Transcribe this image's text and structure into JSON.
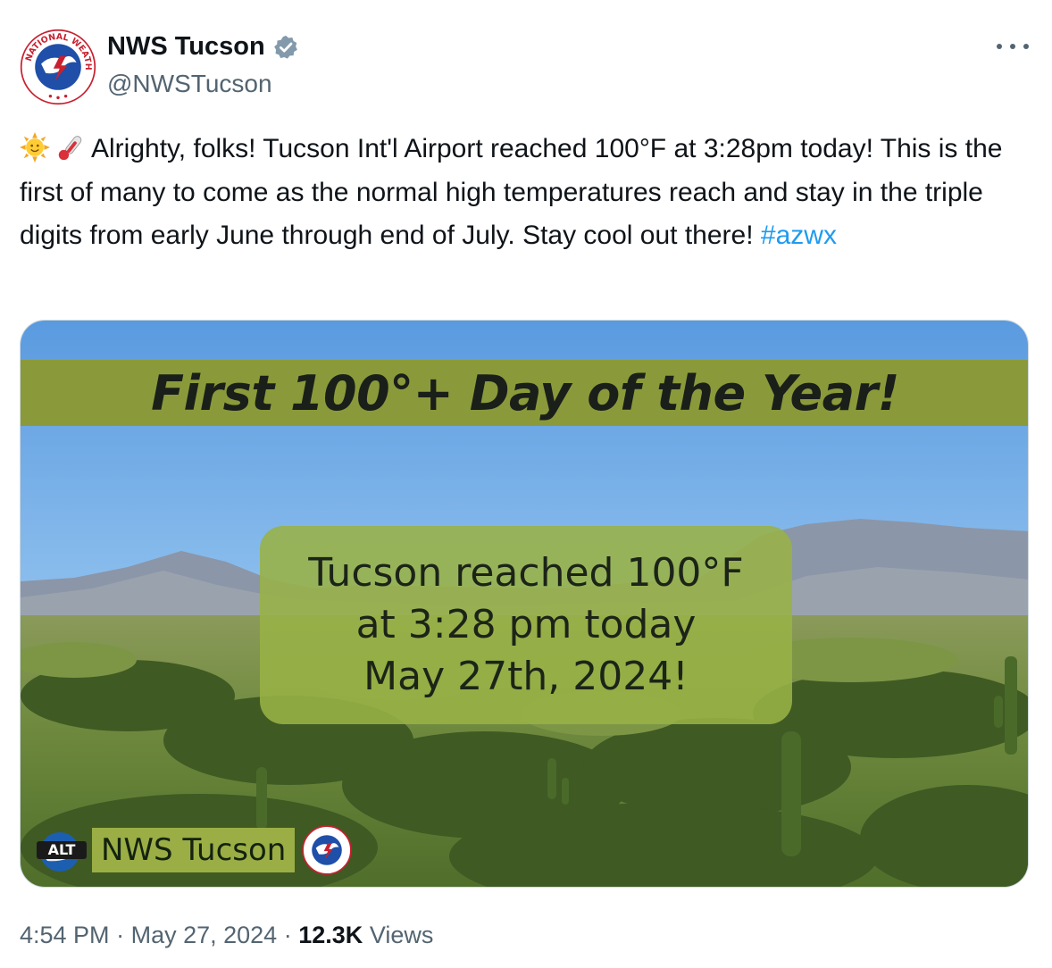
{
  "author": {
    "display_name": "NWS Tucson",
    "handle": "@NWSTucson",
    "avatar_icon": "nws-logo-icon",
    "verified_icon": "verified-badge-icon"
  },
  "tweet": {
    "emojis": [
      "sun-face-icon",
      "thermometer-icon"
    ],
    "text": "Alrighty, folks! Tucson Int'l Airport reached 100°F at 3:28pm today! This is the first of many to come as the normal high temperatures reach and stay in the triple digits from early June through end of July. Stay cool out there!",
    "hashtag": "#azwx"
  },
  "media": {
    "banner_title": "First 100°+ Day of the Year!",
    "center_lines": [
      "Tucson reached 100°F",
      "at 3:28 pm today",
      "May 27th, 2024!"
    ],
    "watermark_badge": "ALT",
    "watermark_label": "NWS Tucson"
  },
  "footer": {
    "time": "4:54 PM",
    "separator": "·",
    "date": "May 27, 2024",
    "views_count": "12.3K",
    "views_label": "Views"
  },
  "colors": {
    "link": "#1d9bf0",
    "secondary_text": "#536471",
    "banner": "#8a9a3a"
  }
}
